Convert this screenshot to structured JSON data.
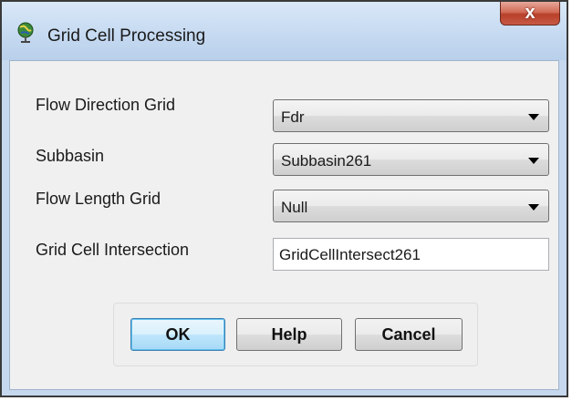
{
  "window": {
    "title": "Grid Cell Processing",
    "close_label": "x"
  },
  "form": {
    "flow_direction": {
      "label": "Flow Direction Grid",
      "value": "Fdr"
    },
    "subbasin": {
      "label": "Subbasin",
      "value": "Subbasin261"
    },
    "flow_length": {
      "label": "Flow Length Grid",
      "value": "Null"
    },
    "grid_cell_intersection": {
      "label": "Grid Cell Intersection",
      "value": "GridCellIntersect261"
    }
  },
  "buttons": {
    "ok": "OK",
    "help": "Help",
    "cancel": "Cancel"
  },
  "icons": {
    "app": "globe-pin-icon",
    "close": "close-icon",
    "dropdown": "chevron-down-icon"
  },
  "colors": {
    "title_bar": "#c6daf1",
    "close_button": "#c75a45",
    "default_button": "#bee6fd"
  }
}
